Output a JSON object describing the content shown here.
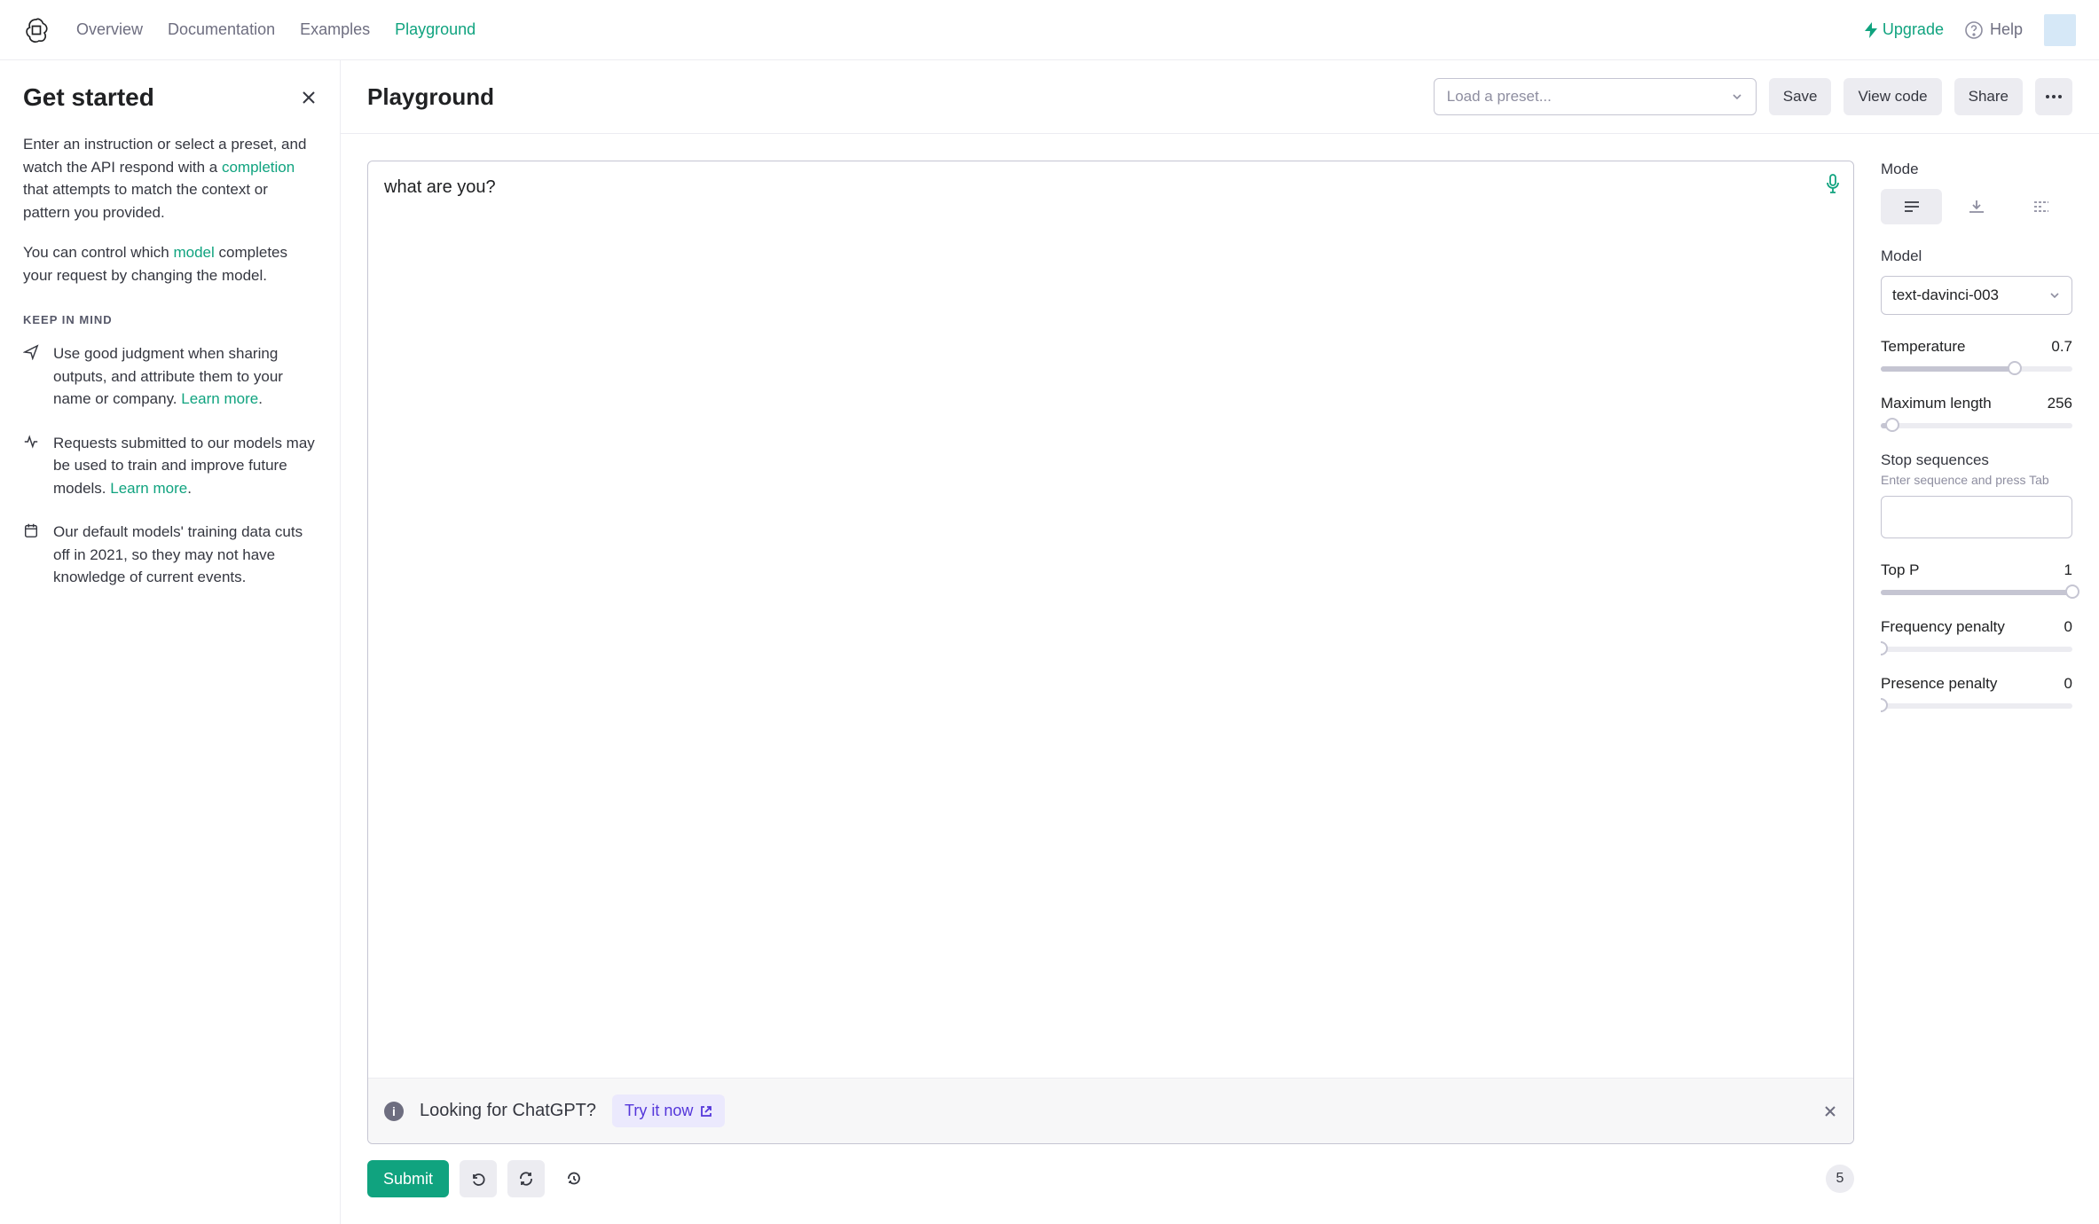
{
  "nav": {
    "links": [
      "Overview",
      "Documentation",
      "Examples",
      "Playground"
    ],
    "active": "Playground",
    "upgrade": "Upgrade",
    "help": "Help"
  },
  "sidebar": {
    "title": "Get started",
    "p1a": "Enter an instruction or select a preset, and watch the API respond with a ",
    "p1link": "completion",
    "p1b": " that attempts to match the context or pattern you provided.",
    "p2a": "You can control which ",
    "p2link": "model",
    "p2b": " completes your request by changing the model.",
    "keep_heading": "KEEP IN MIND",
    "items": [
      {
        "icon": "send",
        "text": "Use good judgment when sharing outputs, and attribute them to your name or company. ",
        "link": "Learn more",
        "link_suffix": "."
      },
      {
        "icon": "activity",
        "text": "Requests submitted to our models may be used to train and improve future models. ",
        "link": "Learn more",
        "link_suffix": "."
      },
      {
        "icon": "calendar",
        "text": "Our default models' training data cuts off in 2021, so they may not have knowledge of current events.",
        "link": "",
        "link_suffix": ""
      }
    ]
  },
  "header": {
    "title": "Playground",
    "preset_placeholder": "Load a preset...",
    "save": "Save",
    "view_code": "View code",
    "share": "Share"
  },
  "editor": {
    "content": "what are you?",
    "banner_text": "Looking for ChatGPT?",
    "tryit": "Try it now",
    "submit": "Submit",
    "token_count": "5"
  },
  "settings": {
    "mode_label": "Mode",
    "model_label": "Model",
    "model_value": "text-davinci-003",
    "params": {
      "temperature": {
        "label": "Temperature",
        "value": "0.7",
        "percent": 70
      },
      "max_length": {
        "label": "Maximum length",
        "value": "256",
        "percent": 6
      },
      "top_p": {
        "label": "Top P",
        "value": "1",
        "percent": 100
      },
      "freq_pen": {
        "label": "Frequency penalty",
        "value": "0",
        "percent": 0
      },
      "pres_pen": {
        "label": "Presence penalty",
        "value": "0",
        "percent": 0
      }
    },
    "stop_label": "Stop sequences",
    "stop_hint": "Enter sequence and press Tab"
  }
}
